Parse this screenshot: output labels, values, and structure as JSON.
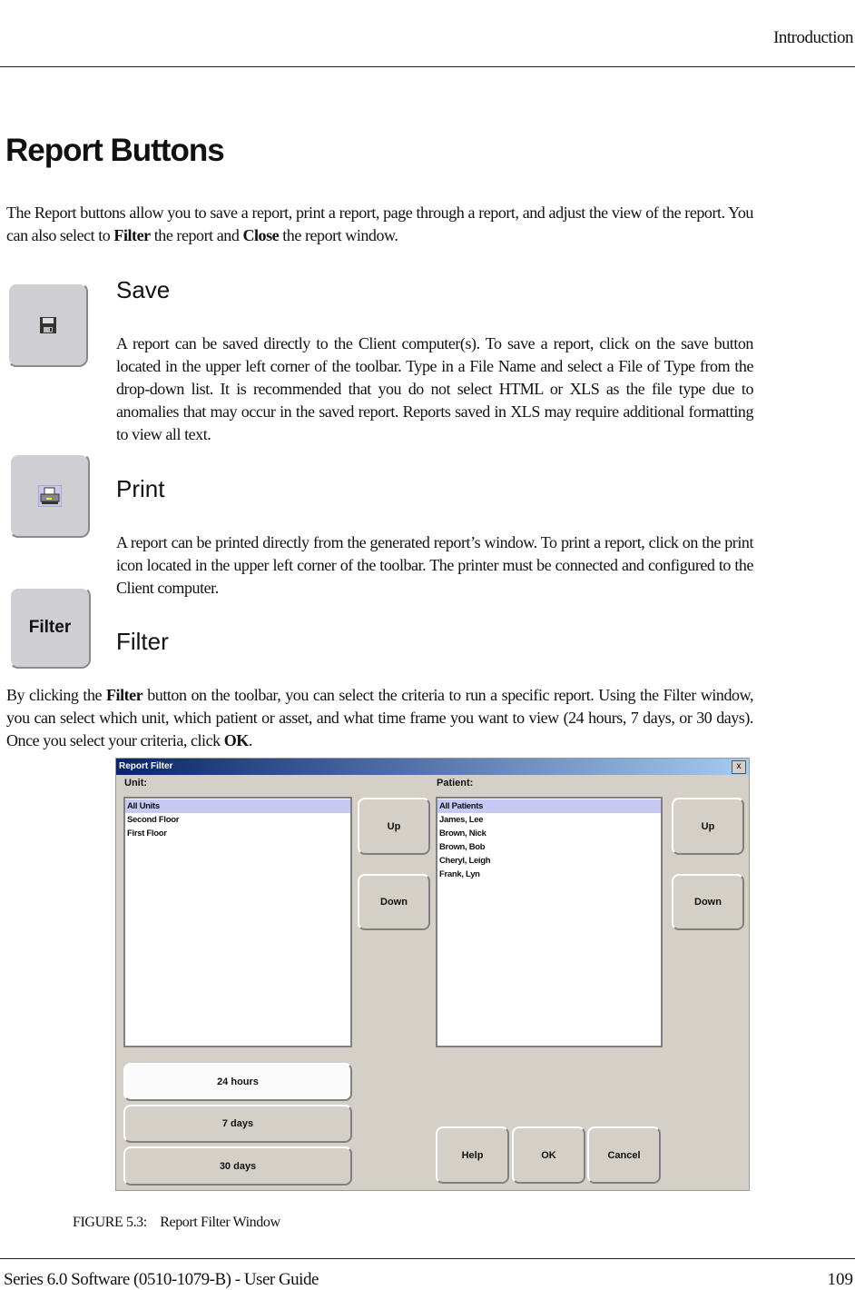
{
  "header": {
    "section": "Introduction"
  },
  "title": "Report Buttons",
  "intro": [
    "The Report buttons allow you to save a report, print a report, page through a report, and adjust the view of the report. You can also select to ",
    "Filter",
    " the report and ",
    "Close",
    " the report window."
  ],
  "save": {
    "heading": "Save",
    "icon": "floppy-disk-icon",
    "text": "A report can be saved directly to the Client computer(s). To save a report, click on the save button located in the upper left corner of the toolbar. Type in a File Name and select a File of Type from the drop-down list. It is recommended that you do not select HTML or XLS as the file type due to anomalies that may occur in the saved report. Reports saved in XLS may require additional formatting to view all text."
  },
  "print": {
    "heading": "Print",
    "icon": "printer-icon",
    "text": "A report can be printed directly from the generated report’s window. To print a report, click on the print icon located in the upper left corner of the toolbar. The printer must be connected and configured to the Client computer."
  },
  "filter": {
    "heading": "Filter",
    "button_label": "Filter",
    "text": [
      "By clicking the ",
      "Filter",
      " button on the toolbar, you can select the criteria to run a specific report. Using the Filter window, you can select which unit, which patient or asset, and what time frame you want to view (24 hours, 7 days, or 30 days). Once you select your criteria, click ",
      "OK",
      "."
    ]
  },
  "window": {
    "title": "Report Filter",
    "close": "x",
    "unit_label": "Unit:",
    "patient_label": "Patient:",
    "units": [
      "All Units",
      "Second Floor",
      "First Floor"
    ],
    "patients": [
      "All Patients",
      "James, Lee",
      "Brown, Nick",
      "Brown, Bob",
      "Cheryl, Leigh",
      "Frank, Lyn"
    ],
    "up": "Up",
    "down": "Down",
    "times": [
      "24 hours",
      "7 days",
      "30 days"
    ],
    "help": "Help",
    "ok": "OK",
    "cancel": "Cancel"
  },
  "caption": {
    "label": "FIGURE 5.3:",
    "text": "Report Filter Window"
  },
  "footer": {
    "left": "Series 6.0 Software (0510-1079-B) - User Guide",
    "page": "109"
  }
}
